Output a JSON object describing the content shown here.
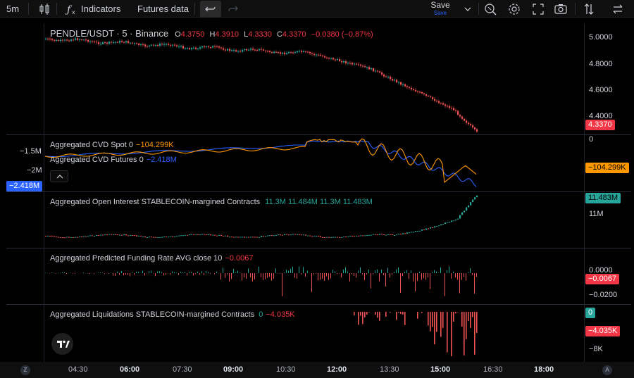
{
  "toolbar": {
    "interval": "5m",
    "indicators_label": "Indicators",
    "futures_label": "Futures data",
    "save_label": "Save",
    "save_sub": "Save",
    "icons": [
      "candles-icon",
      "fx-icon",
      "undo-icon",
      "redo-icon",
      "chevron-down-icon",
      "replay-icon",
      "gear-icon",
      "fullscreen-icon",
      "camera-icon",
      "compare-arrows-icon",
      "swap-icon"
    ]
  },
  "main_pane": {
    "title": "PENDLE/USDT · 5 · Binance",
    "o_label": "O",
    "o": "4.3750",
    "h_label": "H",
    "h": "4.3910",
    "l_label": "L",
    "l": "4.3330",
    "c_label": "C",
    "c": "4.3370",
    "change": "−0.0380 (−0.87%)",
    "axis": [
      "5.0000",
      "4.8000",
      "4.6000",
      "4.4000"
    ],
    "last_price": "4.3370"
  },
  "cvd_pane": {
    "spot_label": "Aggregated CVD Spot 0",
    "spot_value": "−104.299K",
    "futures_label": "Aggregated CVD Futures 0",
    "futures_value": "−2.418M",
    "left_axis": [
      "−1.5M",
      "−2M"
    ],
    "left_tag": "−2.418M",
    "right_axis": [
      "0"
    ],
    "right_tag": "−104.299K"
  },
  "oi_pane": {
    "label": "Aggregated Open Interest STABLECOIN-margined Contracts",
    "values": "11.3M  11.484M  11.3M  11.483M",
    "axis": [
      "11M"
    ],
    "tag": "11.483M"
  },
  "funding_pane": {
    "label": "Aggregated Predicted Funding Rate AVG close 10",
    "value": "−0.0067",
    "axis": [
      "0.0000",
      "−0.0200"
    ],
    "tag": "−0.0067"
  },
  "liq_pane": {
    "label": "Aggregated Liquidations STABLECOIN-margined Contracts",
    "v1": "0",
    "v2": "−4.035K",
    "axis": [
      "−8K"
    ],
    "tag_green": "0",
    "tag_red": "−4.035K"
  },
  "time_axis": {
    "labels": [
      "04:30",
      "06:00",
      "07:30",
      "09:00",
      "10:30",
      "12:00",
      "13:30",
      "15:00",
      "16:30",
      "18:00"
    ],
    "bold": [
      false,
      true,
      false,
      true,
      false,
      true,
      false,
      true,
      false,
      true
    ],
    "left_btn": "Z",
    "right_btn": "A"
  },
  "colors": {
    "up": "#26a69a",
    "down": "#ef5350",
    "cvd_spot": "#ff9800",
    "cvd_futures": "#2962ff",
    "oi_text": "#26a69a",
    "down_text": "#f23645",
    "accent": "#2962ff"
  }
}
